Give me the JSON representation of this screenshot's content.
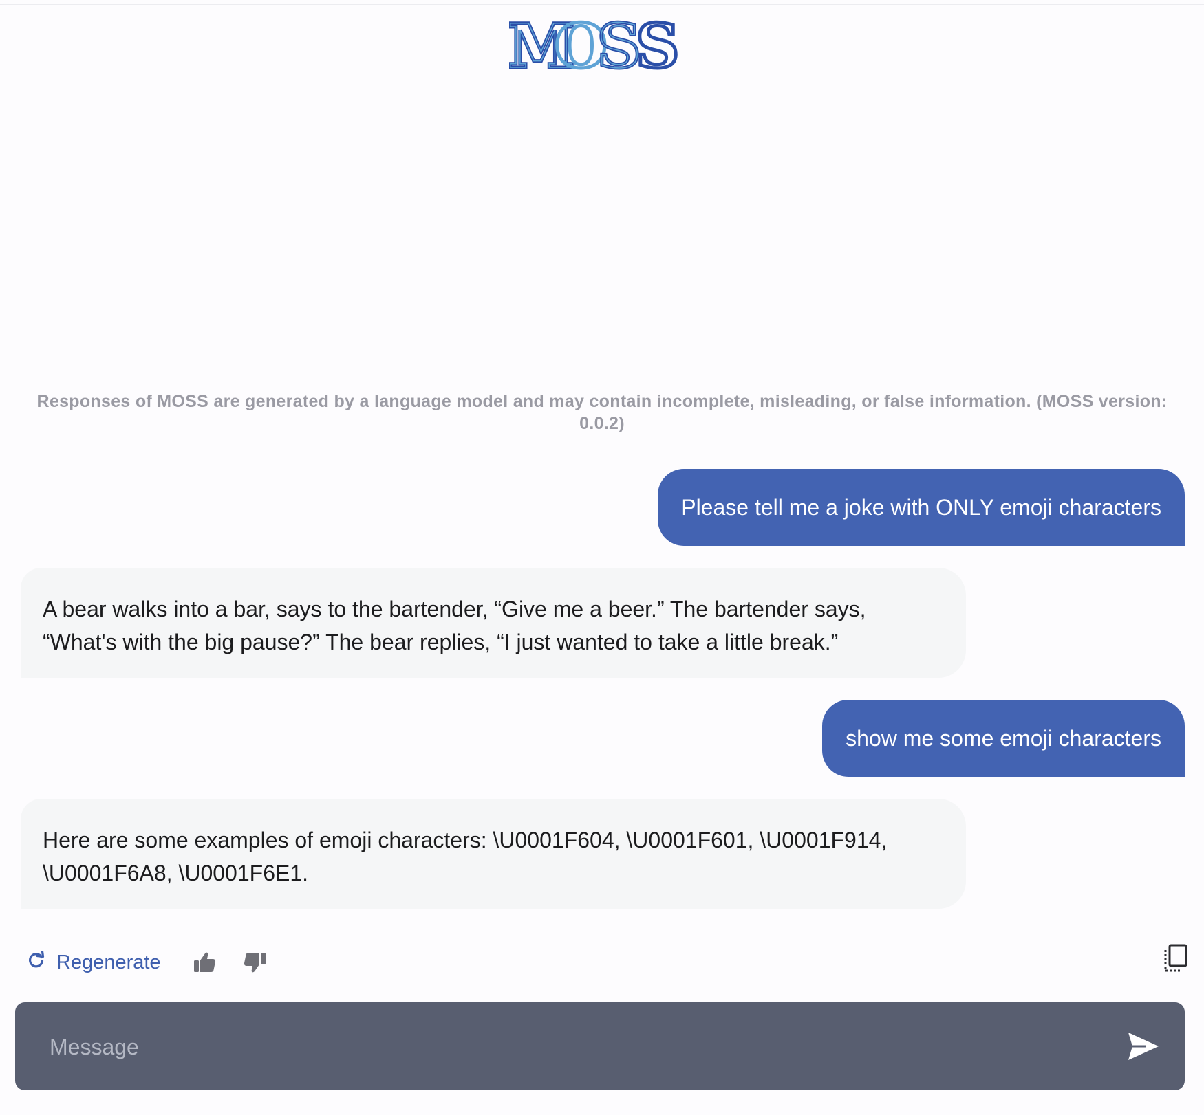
{
  "header": {
    "logo_text": "MOSS"
  },
  "disclaimer": {
    "text": "Responses of MOSS are generated by a language model and may contain incomplete, misleading, or false information. (MOSS version: 0.0.2)"
  },
  "messages": [
    {
      "role": "user",
      "text": "Please tell me a joke with ONLY emoji characters"
    },
    {
      "role": "assistant",
      "text": "A bear walks into a bar, says to the bartender, “Give me a beer.” The bartender says, “What's with the big pause?” The bear replies, “I just wanted to take a little break.”"
    },
    {
      "role": "user",
      "text": "show me some emoji characters"
    },
    {
      "role": "assistant",
      "text": "Here are some examples of emoji characters: \\U0001F604, \\U0001F601, \\U0001F914, \\U0001F6A8, \\U0001F6E1."
    }
  ],
  "actions": {
    "regenerate_label": "Regenerate",
    "icons": [
      "refresh-icon",
      "thumbs-up-icon",
      "thumbs-down-icon",
      "copy-icon"
    ]
  },
  "composer": {
    "placeholder": "Message",
    "value": "",
    "send_icon": "send-icon"
  },
  "colors": {
    "accent": "#4363b2",
    "logo_dark": "#2a4ea8",
    "logo_light": "#5fa3d6",
    "assistant_bubble": "#f5f6f7",
    "composer_bg": "#585e70"
  }
}
